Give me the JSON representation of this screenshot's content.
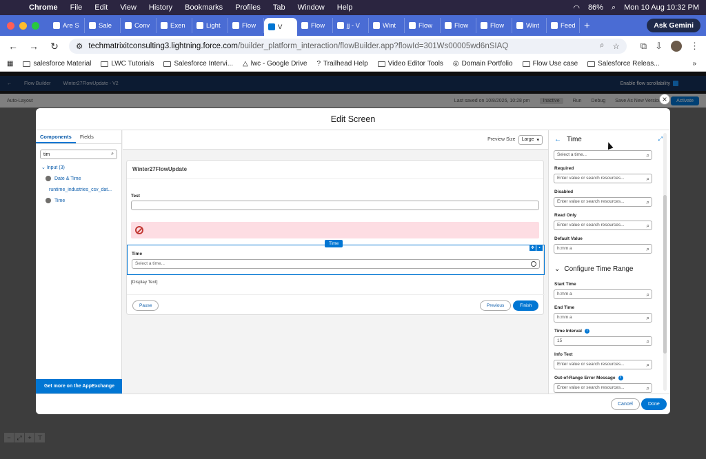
{
  "menubar": {
    "app": "Chrome",
    "items": [
      "File",
      "Edit",
      "View",
      "History",
      "Bookmarks",
      "Profiles",
      "Tab",
      "Window",
      "Help"
    ],
    "battery": "86%",
    "clock": "Mon 10 Aug 10:32 PM"
  },
  "tabs": [
    {
      "label": "Are S"
    },
    {
      "label": "Sale"
    },
    {
      "label": "Conv"
    },
    {
      "label": "Exen"
    },
    {
      "label": "Light"
    },
    {
      "label": "Flow"
    },
    {
      "label": "V",
      "active": true
    },
    {
      "label": "Flow"
    },
    {
      "label": "jj - V"
    },
    {
      "label": "Wint"
    },
    {
      "label": "Flow"
    },
    {
      "label": "Flow"
    },
    {
      "label": "Flow"
    },
    {
      "label": "Wint"
    },
    {
      "label": "Feed"
    }
  ],
  "gemini": "Ask Gemini",
  "address": {
    "host": "techmatrixitconsulting3.lightning.force.com",
    "path": "/builder_platform_interaction/flowBuilder.app?flowId=301Ws00005wd6nSIAQ"
  },
  "bookmarks": [
    "salesforce Material",
    "LWC Tutorials",
    "Salesforce Intervi...",
    "lwc - Google Drive",
    "Trailhead Help",
    "Video Editor Tools",
    "Domain Portfolio",
    "Flow Use case",
    "Salesforce Releas..."
  ],
  "builder": {
    "app_name": "Flow Builder",
    "flow_name": "Winter27FlowUpdate - V2",
    "scroll_toggle": "Enable flow scrollability",
    "layout": "Auto-Layout",
    "last_saved": "Last saved on 10/8/2026, 10:28 pm",
    "status": "Inactive",
    "run": "Run",
    "debug": "Debug",
    "save_as": "Save As New Version",
    "activate": "Activate"
  },
  "modal": {
    "title": "Edit Screen",
    "left": {
      "tabs": [
        "Components",
        "Fields"
      ],
      "search_value": "tim",
      "group": "Input (3)",
      "items": [
        "Date & Time",
        "runtime_industries_csv_dat...",
        "Time"
      ],
      "appexchange": "Get more on the AppExchange"
    },
    "center": {
      "preview_label": "Preview Size",
      "preview_value": "Large",
      "screen_title": "Winter27FlowUpdate",
      "test_label": "Test",
      "time_chip": "Time",
      "time_label": "Time",
      "time_placeholder": "Select a time...",
      "display_text": "[Display Text]",
      "pause": "Pause",
      "previous": "Previous",
      "finish": "Finish"
    },
    "right": {
      "title": "Time",
      "top_placeholder": "Select a time...",
      "fields": [
        {
          "label": "Required",
          "value": "Enter value or search resources..."
        },
        {
          "label": "Disabled",
          "value": "Enter value or search resources..."
        },
        {
          "label": "Read Only",
          "value": "Enter value or search resources..."
        },
        {
          "label": "Default Value",
          "value": "h:mm a"
        }
      ],
      "section": "Configure Time Range",
      "range_fields": [
        {
          "label": "Start Time",
          "value": "h:mm a"
        },
        {
          "label": "End Time",
          "value": "h:mm a"
        },
        {
          "label": "Time Interval",
          "value": "15",
          "info": true
        },
        {
          "label": "Info Text",
          "value": "Enter value or search resources..."
        },
        {
          "label": "Out-of-Range Error Message",
          "value": "Enter value or search resources...",
          "info": true
        }
      ]
    },
    "cancel": "Cancel",
    "done": "Done"
  }
}
